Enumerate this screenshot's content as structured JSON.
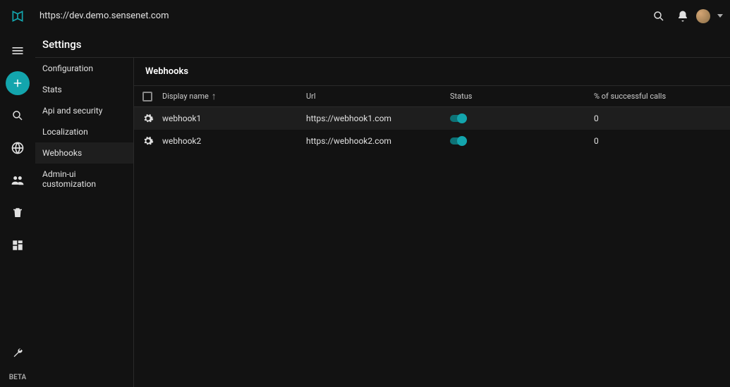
{
  "topbar": {
    "url": "https://dev.demo.sensenet.com"
  },
  "header": {
    "title": "Settings"
  },
  "sidebar": {
    "items": [
      {
        "label": "Configuration"
      },
      {
        "label": "Stats"
      },
      {
        "label": "Api and security"
      },
      {
        "label": "Localization"
      },
      {
        "label": "Webhooks"
      },
      {
        "label": "Admin-ui customization"
      }
    ]
  },
  "panel": {
    "title": "Webhooks",
    "columns": {
      "name": "Display name",
      "url": "Url",
      "status": "Status",
      "pct": "% of successful calls"
    },
    "rows": [
      {
        "name": "webhook1",
        "url": "https://webhook1.com",
        "pct": "0"
      },
      {
        "name": "webhook2",
        "url": "https://webhook2.com",
        "pct": "0"
      }
    ]
  },
  "rail": {
    "beta": "BETA"
  }
}
